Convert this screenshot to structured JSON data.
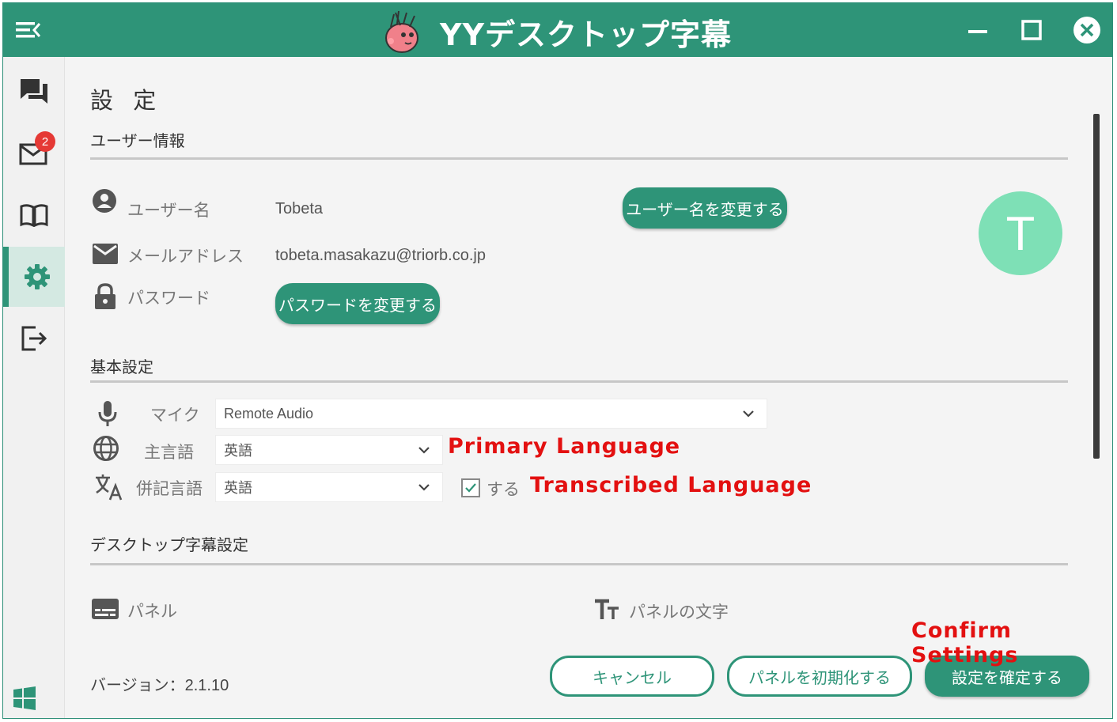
{
  "app": {
    "title": "YYデスクトップ字幕"
  },
  "colors": {
    "brand": "#2e9478",
    "avatar": "#7ee0b6",
    "badge": "#e53935",
    "annotation": "#e31010"
  },
  "sidebar": {
    "items": [
      {
        "name": "chat",
        "icon": "chat-icon"
      },
      {
        "name": "mail",
        "icon": "mail-icon",
        "badge": "2"
      },
      {
        "name": "book",
        "icon": "book-icon"
      },
      {
        "name": "settings",
        "icon": "gear-icon",
        "active": true
      },
      {
        "name": "logout",
        "icon": "logout-icon"
      }
    ],
    "windows_icon": "windows-logo-icon"
  },
  "settings": {
    "title": "設 定",
    "user_section": {
      "title": "ユーザー情報",
      "username_label": "ユーザー名",
      "username_value": "Tobeta",
      "email_label": "メールアドレス",
      "email_value": "tobeta.masakazu@triorb.co.jp",
      "password_label": "パスワード",
      "change_username_button": "ユーザー名を変更する",
      "change_password_button": "パスワードを変更する",
      "avatar_letter": "T"
    },
    "basic_section": {
      "title": "基本設定",
      "mic_label": "マイク",
      "mic_value": "Remote Audio",
      "primary_lang_label": "主言語",
      "primary_lang_value": "英語",
      "secondary_lang_label": "併記言語",
      "secondary_lang_value": "英語",
      "secondary_enable_label": "する",
      "secondary_enable_checked": true
    },
    "desktop_section": {
      "title": "デスクトップ字幕設定",
      "panel_label": "パネル",
      "panel_text_label": "パネルの文字"
    },
    "footer": {
      "version": "バージョン：2.1.10",
      "cancel_button": "キャンセル",
      "reset_button": "パネルを初期化する",
      "confirm_button": "設定を確定する"
    }
  },
  "annotations": {
    "primary_language": "Primary Language",
    "transcribed_language": "Transcribed Language",
    "confirm_settings": "Confirm Settings"
  }
}
